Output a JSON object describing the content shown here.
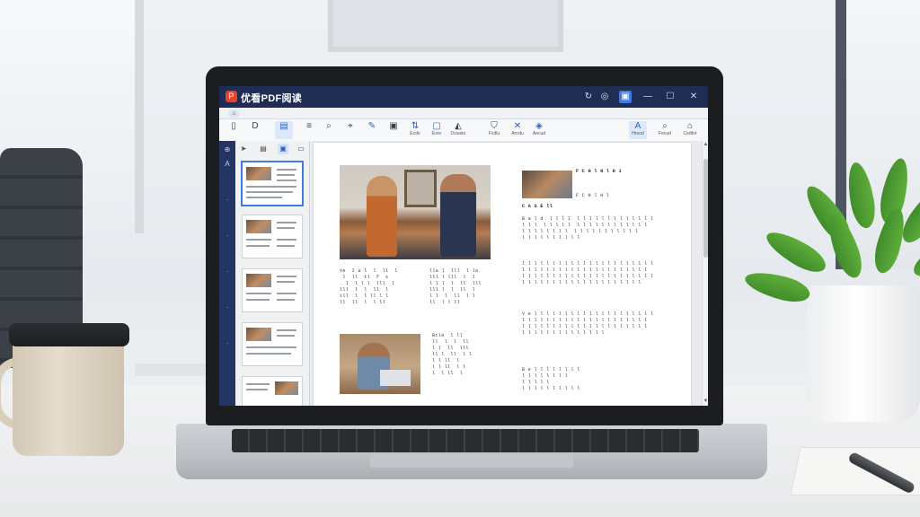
{
  "app": {
    "title": "优看PDF阅读",
    "logo_glyph": "P",
    "accent": "#3f7be0",
    "titlebar_color": "#1f2d55"
  },
  "window_controls": {
    "refresh_icon": "refresh-icon",
    "user_icon": "user-icon",
    "skin_icon": "skin-icon",
    "minimize": "—",
    "maximize": "☐",
    "close": "✕"
  },
  "tabs": {
    "home_glyph": "⌂"
  },
  "ribbon": {
    "tools": [
      {
        "icon": "▯",
        "label": ""
      },
      {
        "icon": "D",
        "label": ""
      },
      {
        "icon": "▤",
        "label": ""
      },
      {
        "icon": "≡",
        "label": ""
      },
      {
        "icon": "⌕",
        "label": ""
      },
      {
        "icon": "⌖",
        "label": ""
      },
      {
        "icon": "✎",
        "label": ""
      },
      {
        "icon": "▣",
        "label": ""
      },
      {
        "icon": "⇅",
        "label": "Ecdo"
      },
      {
        "icon": "▢",
        "label": "Exro"
      },
      {
        "icon": "◭",
        "label": "Ocwsto"
      },
      {
        "icon": "⛉",
        "label": "Fcdlu"
      },
      {
        "icon": "✕",
        "label": "Arrotu"
      },
      {
        "icon": "◈",
        "label": "Aecud"
      },
      {
        "icon": "A",
        "label": "Hrood"
      },
      {
        "icon": "⌕",
        "label": "Fecud"
      },
      {
        "icon": "⌂",
        "label": "Cedtre"
      }
    ]
  },
  "sidebar_icons": [
    "⊕",
    "A",
    "",
    "",
    "",
    "",
    ""
  ],
  "thumb_tools": [
    "➤",
    "▤",
    "▣",
    "▭"
  ],
  "thumbnails": [
    {
      "page": 1,
      "selected": true
    },
    {
      "page": 2,
      "selected": false
    },
    {
      "page": 3,
      "selected": false
    },
    {
      "page": 4,
      "selected": false
    },
    {
      "page": 5,
      "selected": false
    }
  ],
  "document": {
    "left_col": {
      "caption_a": "Ve  I a l  l  ll  l\n l  ll  tl  f  s\n. I  l l l  lll  l\nlll  l  l  ll  l\ntll  l  l ll l l\nll  ll  l  l ll",
      "caption_b": "lla l  lll  l la\nlll l lll  l  l\nl l l  l  ll  lll\nlll l  l  ll  l\nl l  l  ll  l l\nll  l l ll",
      "caption_c": "Bcle  l ll\nll  l  l  ll\nl l  ll  lll\nll l  ll  l l\nl l ll  l\nl l ll  l l\nl  l ll  l"
    },
    "right_col": {
      "head": "F C H l H l H i",
      "subhead": "F C H l H l",
      "section": "C A S E ll",
      "para1": "B a l d  l l l I  l l l l l l l l l l l l l\nl l l  l l l l l  l l l l l l l l l l l l\nl l l l l l l l  l l l l l l l l l l l\nl l l l l l l l l l",
      "para2": "l l l l l l l l l l l l l l l l l l l l l l\nl l l l l l l l l l l l l l l l l l l l l\nl l l l l l l l l l l l l l l l l l l l l l\nl l l l l l l l l l l l l l l l l l l l",
      "para3": "V e l l l l l l l l l l l l l l l l l l l l\nl l l l l l l l l l l l l l l l l l l l l\nl l l l l l l l l l l l l l l l l l l l l\nl l l l l l l l l l l l l l",
      "para4": "B e l l l l l l l l\nl l l l l l l l\nl l l l l\nl l l l l l l l l l"
    }
  }
}
